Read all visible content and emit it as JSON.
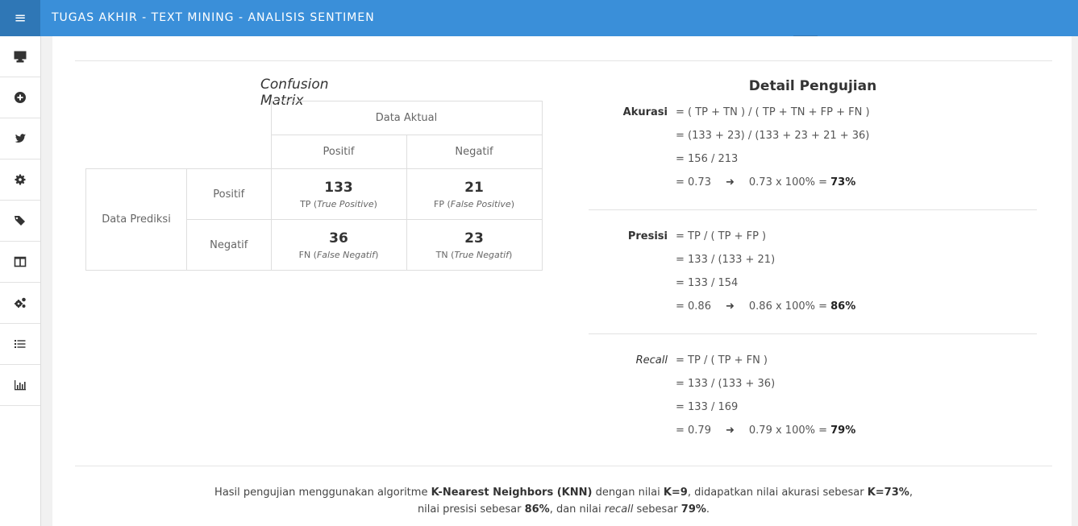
{
  "app": {
    "title": "TUGAS AKHIR - TEXT MINING - ANALISIS SENTIMEN"
  },
  "sidebar": {
    "icons": [
      "desktop-icon",
      "plus-circle-icon",
      "twitter-icon",
      "gear-icon",
      "tags-icon",
      "columns-icon",
      "gears-icon",
      "list-icon",
      "bar-chart-icon"
    ]
  },
  "confusion": {
    "title": "Confusion Matrix",
    "actual_header": "Data Aktual",
    "predicted_header": "Data Prediksi",
    "positive": "Positif",
    "negative": "Negatif",
    "tp": {
      "value": "133",
      "label_prefix": "TP (",
      "label_italic": "True Positive",
      "label_suffix": ")"
    },
    "fp": {
      "value": "21",
      "label_prefix": "FP (",
      "label_italic": "False Positive",
      "label_suffix": ")"
    },
    "fn": {
      "value": "36",
      "label_prefix": "FN (",
      "label_italic": "False Negatif",
      "label_suffix": ")"
    },
    "tn": {
      "value": "23",
      "label_prefix": "TN (",
      "label_italic": "True Negatif",
      "label_suffix": ")"
    }
  },
  "detail": {
    "title": "Detail Pengujian",
    "accuracy": {
      "label": "Akurasi",
      "formula": "= ( TP + TN ) / ( TP + TN + FP + FN )",
      "substitute": "= (133 + 23) / (133 + 23 + 21 + 36)",
      "fraction": "= 156 / 213",
      "decimal": "= 0.73",
      "percent_calc": "0.73 x 100% =",
      "result": "73%"
    },
    "precision": {
      "label": "Presisi",
      "formula": "= TP / ( TP + FP )",
      "substitute": "= 133 / (133 + 21)",
      "fraction": "= 133 / 154",
      "decimal": "= 0.86",
      "percent_calc": "0.86 x 100% =",
      "result": "86%"
    },
    "recall": {
      "label": "Recall",
      "formula": "= TP / ( TP + FN )",
      "substitute": "= 133 / (133 + 36)",
      "fraction": "= 133 / 169",
      "decimal": "= 0.79",
      "percent_calc": "0.79 x 100% =",
      "result": "79%"
    }
  },
  "summary": {
    "t1": "Hasil pengujian menggunakan algoritme ",
    "b1": "K-Nearest Neighbors (KNN)",
    "t2": " dengan nilai ",
    "b2": "K=9",
    "t3": ", didapatkan nilai akurasi sebesar ",
    "b3": "K=73%",
    "t4": ", nilai presisi sebesar ",
    "b4": "86%",
    "t5": ", dan nilai ",
    "i1": "recall",
    "t6": " sebesar ",
    "b5": "79%",
    "t7": "."
  }
}
